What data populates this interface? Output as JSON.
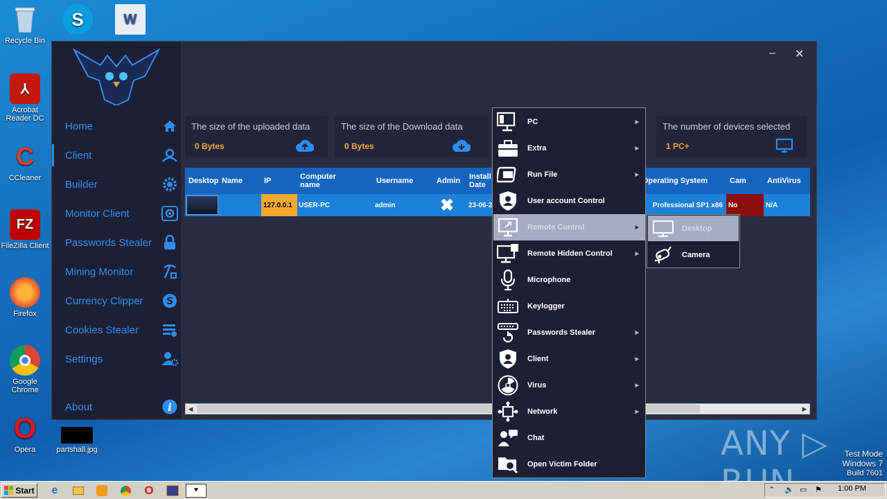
{
  "desktop": {
    "icons": [
      {
        "label": "Recycle Bin"
      },
      {
        "label": "Acrobat Reader DC"
      },
      {
        "label": "CCleaner"
      },
      {
        "label": "FileZilla Client"
      },
      {
        "label": "Firefox"
      },
      {
        "label": "Google Chrome"
      },
      {
        "label": "Opera"
      },
      {
        "label": "partshall.jpg"
      }
    ],
    "watermark": "ANY ▷ RUN",
    "test_mode": {
      "line1": "Test Mode",
      "line2": "Windows 7",
      "line3": "Build 7601"
    }
  },
  "app": {
    "nav": [
      {
        "label": "Home",
        "icon": "home-icon"
      },
      {
        "label": "Client",
        "icon": "user-icon"
      },
      {
        "label": "Builder",
        "icon": "gear-icon"
      },
      {
        "label": "Monitor Client",
        "icon": "eye-icon"
      },
      {
        "label": "Passwords Stealer",
        "icon": "lock-icon"
      },
      {
        "label": "Mining Monitor",
        "icon": "pickaxe-icon"
      },
      {
        "label": "Currency Clipper",
        "icon": "coin-icon"
      },
      {
        "label": "Cookies Stealer",
        "icon": "list-icon"
      },
      {
        "label": "Settings",
        "icon": "user-gear-icon"
      },
      {
        "label": "About",
        "icon": "info-icon"
      }
    ],
    "window_controls": {
      "minimize": "–",
      "close": "✕"
    },
    "cards": [
      {
        "title": "The size of the uploaded data",
        "value": "0 Bytes",
        "icon": "cloud-upload-icon"
      },
      {
        "title": "The size of the Download data",
        "value": "0 Bytes",
        "icon": "cloud-download-icon"
      },
      {
        "title": "The number of devices selected",
        "value": "1 PC+",
        "icon": "monitor-icon"
      }
    ],
    "table": {
      "headers": [
        "Desktop",
        "Name",
        "IP",
        "Computer name",
        "Username",
        "Admin",
        "Install Date",
        "Operating System",
        "Cam",
        "AntiVirus"
      ],
      "rows": [
        {
          "name": "",
          "ip": "127.0.0.1",
          "computer": "USER-PC",
          "username": "admin",
          "admin": "✖",
          "install": "23-06-2",
          "os": "Professional SP1 x86",
          "cam": "No",
          "antivirus": "N/A"
        }
      ]
    },
    "colors": {
      "accent": "#2f8cf0",
      "highlight": "#f0a830",
      "row": "#1a80d8",
      "cam_no": "#8b0e0e"
    }
  },
  "context_menu": {
    "items": [
      {
        "label": "PC",
        "icon": "pc-icon",
        "submenu": true
      },
      {
        "label": "Extra",
        "icon": "toolbox-icon",
        "submenu": true
      },
      {
        "label": "Run File",
        "icon": "run-file-icon",
        "submenu": true
      },
      {
        "label": "User account Control",
        "icon": "shield-user-icon",
        "submenu": false
      },
      {
        "label": "Remote Control",
        "icon": "remote-desktop-icon",
        "submenu": true
      },
      {
        "label": "Remote Hidden Control",
        "icon": "hidden-desktop-icon",
        "submenu": true
      },
      {
        "label": "Microphone",
        "icon": "microphone-icon",
        "submenu": false
      },
      {
        "label": "Keylogger",
        "icon": "keyboard-icon",
        "submenu": false
      },
      {
        "label": "Passwords Stealer",
        "icon": "password-icon",
        "submenu": true
      },
      {
        "label": "Client",
        "icon": "shield-user-icon",
        "submenu": true
      },
      {
        "label": "Virus",
        "icon": "radiation-icon",
        "submenu": true
      },
      {
        "label": "Network",
        "icon": "network-icon",
        "submenu": true
      },
      {
        "label": "Chat",
        "icon": "chat-icon",
        "submenu": false
      },
      {
        "label": "Open Victim Folder",
        "icon": "folder-search-icon",
        "submenu": false
      }
    ],
    "highlighted_index": 4,
    "submenu": {
      "items": [
        {
          "label": "Desktop",
          "icon": "monitor-icon"
        },
        {
          "label": "Camera",
          "icon": "camera-icon"
        }
      ],
      "highlighted_index": 0
    }
  },
  "taskbar": {
    "start_label": "Start",
    "clock": "1:00 PM"
  }
}
